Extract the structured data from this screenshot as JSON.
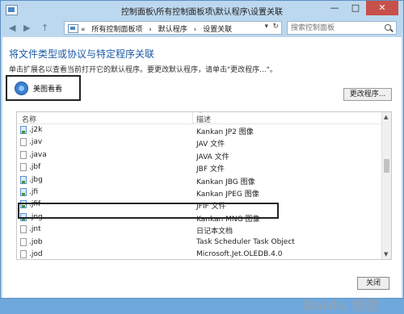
{
  "window": {
    "title": "控制面板\\所有控制面板项\\默认程序\\设置关联",
    "minimize": "—",
    "maximize": "□",
    "close": "✕"
  },
  "nav": {
    "back": "◀",
    "forward": "▶",
    "up": "↑",
    "breadcrumb": [
      "«",
      "所有控制面板项",
      "›",
      "默认程序",
      "›",
      "设置关联"
    ],
    "dropdown": "▾",
    "refresh": "↻",
    "search_placeholder": "搜索控制面板"
  },
  "main": {
    "heading": "将文件类型或协议与特定程序关联",
    "description": "单击扩展名以查看当前打开它的默认程序。要更改默认程序，请单击\"更改程序...\"。",
    "current_app": "美图看看",
    "change_button": "更改程序..."
  },
  "list": {
    "col_name": "名称",
    "col_desc": "描述",
    "rows": [
      {
        "ext": ".j2k",
        "type": "Kankan JP2 图像",
        "icon": "image-file-icon"
      },
      {
        "ext": ".jav",
        "type": "JAV 文件",
        "icon": "file-icon"
      },
      {
        "ext": ".java",
        "type": "JAVA 文件",
        "icon": "file-icon"
      },
      {
        "ext": ".jbf",
        "type": "JBF 文件",
        "icon": "file-icon"
      },
      {
        "ext": ".jbg",
        "type": "Kankan JBG 图像",
        "icon": "image-file-icon"
      },
      {
        "ext": ".jfi",
        "type": "Kankan JPEG 图像",
        "icon": "image-file-icon"
      },
      {
        "ext": ".jfif",
        "type": "JFIF 文件",
        "icon": "image-file-icon"
      },
      {
        "ext": ".jng",
        "type": "Kankan MNG 图像",
        "icon": "image-file-icon"
      },
      {
        "ext": ".jnt",
        "type": "日记本文档",
        "icon": "file-icon"
      },
      {
        "ext": ".job",
        "type": "Task Scheduler Task Object",
        "icon": "file-icon"
      },
      {
        "ext": ".jod",
        "type": "Microsoft.Jet.OLEDB.4.0",
        "icon": "file-icon"
      }
    ]
  },
  "footer": {
    "close_button": "关闭"
  },
  "watermark": "Baidu 经验"
}
